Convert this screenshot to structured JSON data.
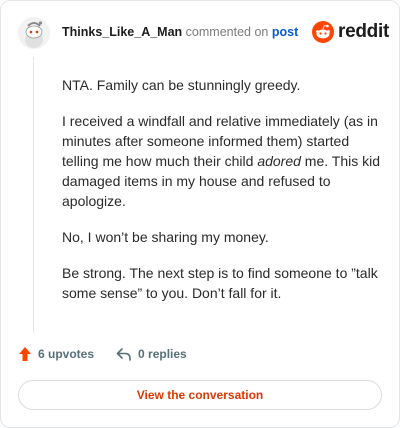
{
  "header": {
    "username": "Thinks_Like_A_Man",
    "commented_text": "commented on",
    "post_link": "post",
    "logo_text": "reddit"
  },
  "comment": {
    "p1": "NTA. Family can be stunningly greedy.",
    "p2_before": "I received a windfall and relative immediately (as in minutes after someone informed them) started telling me how much their child ",
    "p2_em": "adored",
    "p2_after": " me. This kid damaged items in my house and refused to apologize.",
    "p3": "No, I won’t be sharing my money.",
    "p4": "Be strong. The next step is to find someone to ”talk some sense” to you. Don’t fall for it."
  },
  "actions": {
    "upvotes": "6 upvotes",
    "replies": "0 replies"
  },
  "cta_label": "View the conversation",
  "colors": {
    "brand": "#ff4500",
    "link": "#0a5bd3",
    "cta_text": "#d93a00"
  }
}
